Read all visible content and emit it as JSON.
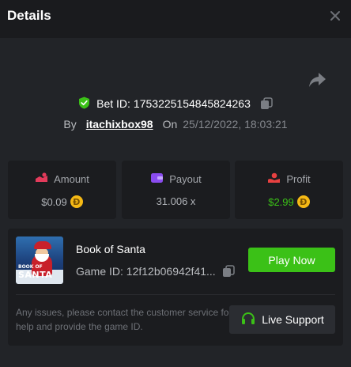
{
  "header": {
    "title": "Details"
  },
  "bet": {
    "id_label": "Bet ID:",
    "id_value": "1753225154845824263",
    "by_label": "By",
    "username": "itachixbox98",
    "on_label": "On",
    "datetime": "25/12/2022, 18:03:21"
  },
  "stats": {
    "amount": {
      "label": "Amount",
      "value": "$0.09",
      "coin": "Ð"
    },
    "payout": {
      "label": "Payout",
      "value": "31.006 x"
    },
    "profit": {
      "label": "Profit",
      "value": "$2.99",
      "coin": "Ð"
    }
  },
  "game": {
    "thumb_line1": "BOOK OF",
    "thumb_line2": "SANTA",
    "name": "Book of Santa",
    "id_label": "Game ID:",
    "id_value": "12f12b06942f41...",
    "play_label": "Play Now"
  },
  "support": {
    "message": "Any issues, please contact the customer service for help and provide the game ID.",
    "button_label": "Live Support"
  },
  "colors": {
    "accent_green": "#3bc117",
    "coin_gold": "#f5b915",
    "amount_icon": "#e33b5b",
    "payout_icon": "#8a4cf0",
    "profit_icon": "#e84141"
  },
  "icons": [
    "close-icon",
    "share-icon",
    "shield-check-icon",
    "copy-icon",
    "amount-icon",
    "payout-icon",
    "profit-icon",
    "coin-icon",
    "headset-icon"
  ]
}
